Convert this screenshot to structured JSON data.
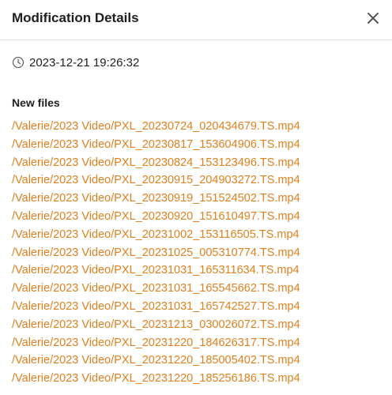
{
  "dialog": {
    "title": "Modification Details",
    "close_icon": "close-icon",
    "clock_icon": "clock-icon",
    "timestamp": "2023-12-21 19:26:32",
    "section_title": "New files",
    "link_color": "#e0801f",
    "files": [
      "/Valerie/2023 Video/PXL_20230724_020434679.TS.mp4",
      "/Valerie/2023 Video/PXL_20230817_153604906.TS.mp4",
      "/Valerie/2023 Video/PXL_20230824_153123496.TS.mp4",
      "/Valerie/2023 Video/PXL_20230915_204903272.TS.mp4",
      "/Valerie/2023 Video/PXL_20230919_151524502.TS.mp4",
      "/Valerie/2023 Video/PXL_20230920_151610497.TS.mp4",
      "/Valerie/2023 Video/PXL_20231002_153116505.TS.mp4",
      "/Valerie/2023 Video/PXL_20231025_005310774.TS.mp4",
      "/Valerie/2023 Video/PXL_20231031_165311634.TS.mp4",
      "/Valerie/2023 Video/PXL_20231031_165545662.TS.mp4",
      "/Valerie/2023 Video/PXL_20231031_165742527.TS.mp4",
      "/Valerie/2023 Video/PXL_20231213_030026072.TS.mp4",
      "/Valerie/2023 Video/PXL_20231220_184626317.TS.mp4",
      "/Valerie/2023 Video/PXL_20231220_185005402.TS.mp4",
      "/Valerie/2023 Video/PXL_20231220_185256186.TS.mp4"
    ]
  }
}
